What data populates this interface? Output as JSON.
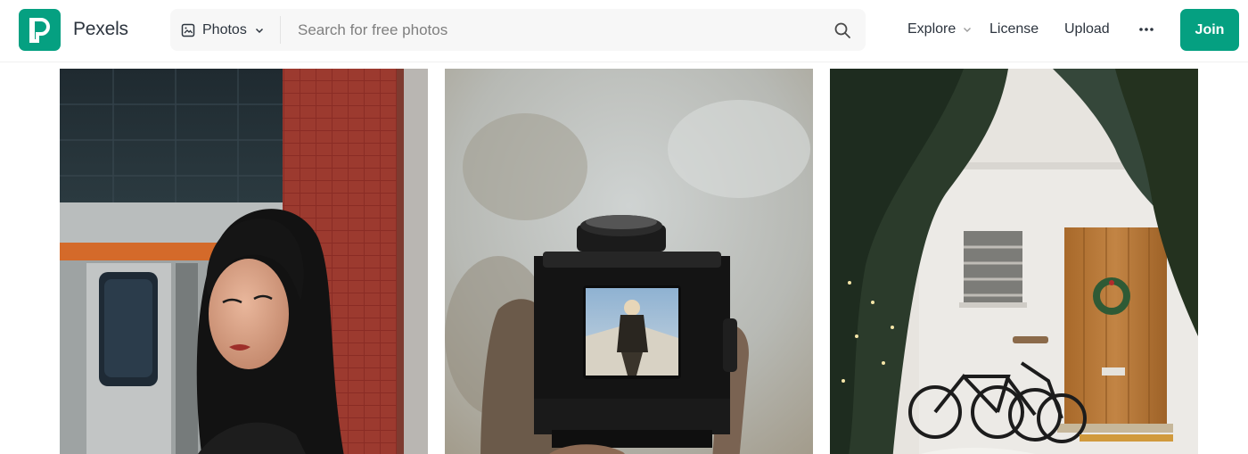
{
  "brand": {
    "name": "Pexels",
    "color": "#05a081"
  },
  "search": {
    "type_label": "Photos",
    "placeholder": "Search for free photos",
    "icons": [
      "image-icon",
      "chevron-down-icon",
      "search-icon"
    ]
  },
  "nav": {
    "explore": "Explore",
    "license": "License",
    "upload": "Upload",
    "more_icon": "more-horizontal-icon",
    "join": "Join"
  },
  "photos": [
    {
      "subject": "woman-by-red-tile-wall-and-train"
    },
    {
      "subject": "hand-holding-twin-lens-camera"
    },
    {
      "subject": "white-house-with-bicycles-and-trees"
    }
  ]
}
